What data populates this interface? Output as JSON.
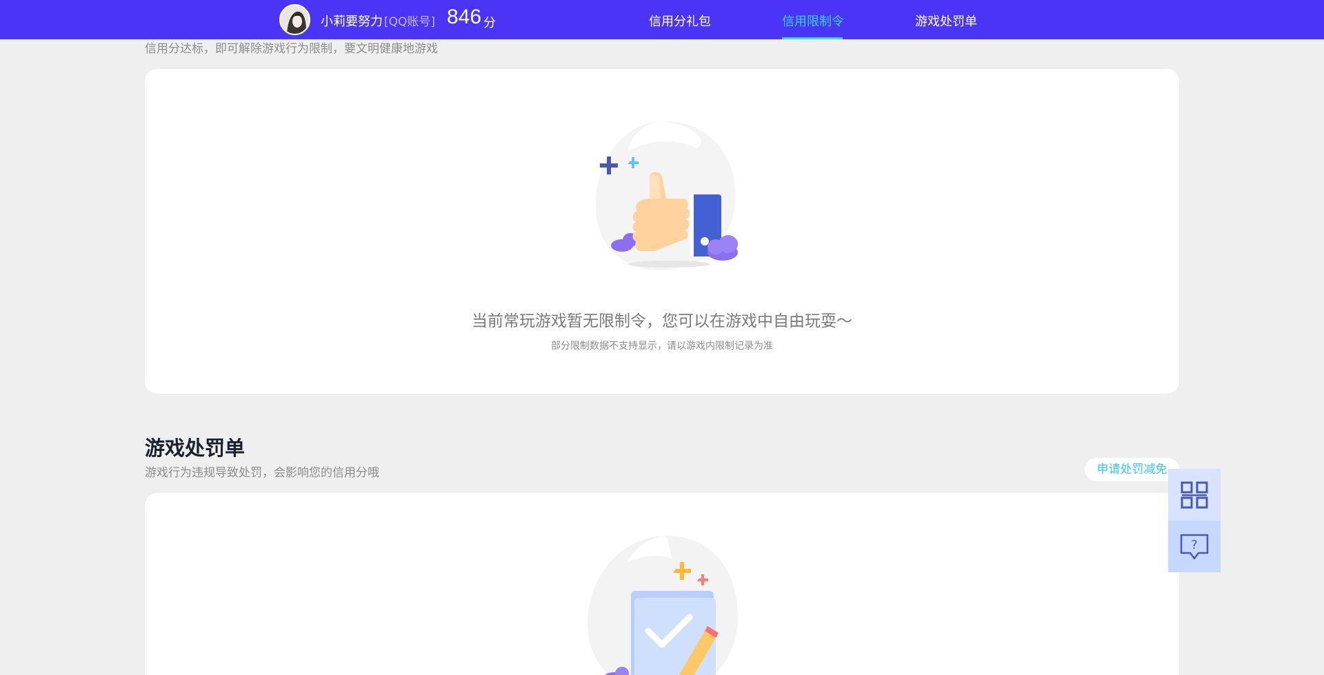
{
  "header": {
    "username": "小莉要努力",
    "account_type": "[QQ账号]",
    "score": "846",
    "score_unit": "分",
    "nav": [
      {
        "label": "信用分礼包"
      },
      {
        "label": "信用限制令"
      },
      {
        "label": "游戏处罚单"
      }
    ],
    "active_nav": "信用限制令",
    "accent_color": "#38d3ff",
    "bar_color": "#4a35f7"
  },
  "restriction": {
    "subtitle": "信用分达标，即可解除游戏行为限制，要文明健康地游戏",
    "empty_icon": "thumbs-up-icon",
    "empty_text": "当前常玩游戏暂无限制令，您可以在游戏中自由玩耍～",
    "empty_note": "部分限制数据不支持显示，请以游戏内限制记录为准"
  },
  "penalty": {
    "title": "游戏处罚单",
    "subtitle": "游戏行为违规导致处罚，会影响您的信用分哦",
    "apply_button": "申请处罚减免",
    "empty_icon": "checked-folder-icon"
  },
  "side_tools": [
    {
      "icon": "qrcode-icon"
    },
    {
      "icon": "feedback-help-icon"
    }
  ]
}
